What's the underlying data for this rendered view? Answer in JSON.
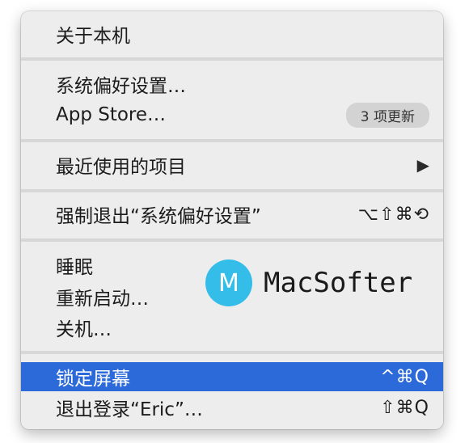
{
  "menu": {
    "about": "关于本机",
    "system_prefs": "系统偏好设置…",
    "app_store": "App Store…",
    "app_store_badge": "3 项更新",
    "recent_items": "最近使用的项目",
    "recent_items_arrow": "▶",
    "force_quit": "强制退出“系统偏好设置”",
    "force_quit_shortcut": "⌥⇧⌘⟲",
    "sleep": "睡眠",
    "restart": "重新启动…",
    "shutdown": "关机…",
    "lock_screen": "锁定屏幕",
    "lock_screen_shortcut": "^⌘Q",
    "logout": "退出登录“Eric”…",
    "logout_shortcut": "⇧⌘Q"
  },
  "watermark": {
    "logo_letter": "M",
    "text": "MacSofter"
  },
  "colors": {
    "menu_background": "#ededed",
    "highlight": "#2d6ad9",
    "watermark_logo": "#34bde8"
  },
  "state": {
    "highlighted_item": "lock_screen"
  }
}
